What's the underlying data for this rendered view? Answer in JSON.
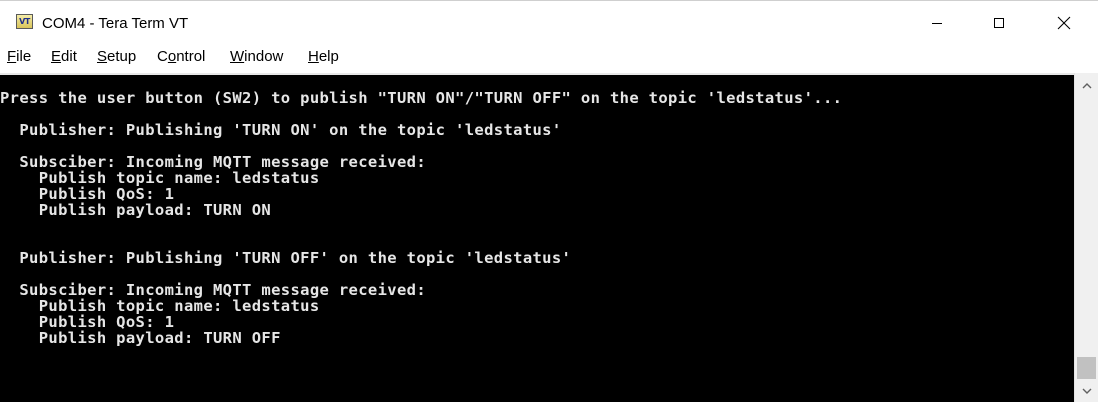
{
  "window": {
    "title": "COM4 - Tera Term VT",
    "icon_label": "VT"
  },
  "icons": {
    "app": "tera-term-vt-icon",
    "minimize": "minimize-icon",
    "maximize": "maximize-icon",
    "close": "close-icon",
    "scroll_up": "chevron-up-icon",
    "scroll_down": "chevron-down-icon"
  },
  "menu": {
    "items": [
      {
        "accel": "F",
        "rest": "ile"
      },
      {
        "accel": "E",
        "rest": "dit"
      },
      {
        "accel": "S",
        "rest": "etup"
      },
      {
        "pre": "C",
        "accel": "o",
        "rest": "ntrol"
      },
      {
        "accel": "W",
        "rest": "indow"
      },
      {
        "accel": "H",
        "rest": "elp"
      }
    ]
  },
  "terminal": {
    "background": "#000000",
    "foreground": "#e6e6e6",
    "lines": [
      "Press the user button (SW2) to publish \"TURN ON\"/\"TURN OFF\" on the topic 'ledstatus'...",
      "  Publisher: Publishing 'TURN ON' on the topic 'ledstatus'",
      "  Subsciber: Incoming MQTT message received:",
      "    Publish topic name: ledstatus",
      "    Publish QoS: 1",
      "    Publish payload: TURN ON",
      "  Publisher: Publishing 'TURN OFF' on the topic 'ledstatus'",
      "  Subsciber: Incoming MQTT message received:",
      "    Publish topic name: ledstatus",
      "    Publish QoS: 1",
      "    Publish payload: TURN OFF"
    ]
  }
}
